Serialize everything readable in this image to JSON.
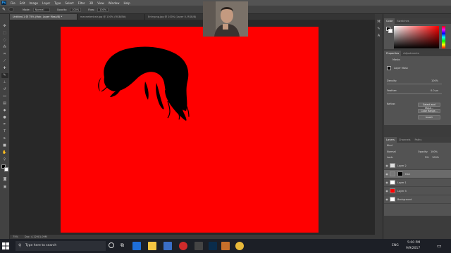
{
  "app": {
    "logo": "Ps"
  },
  "menu": [
    "File",
    "Edit",
    "Image",
    "Layer",
    "Type",
    "Select",
    "Filter",
    "3D",
    "View",
    "Window",
    "Help"
  ],
  "options": {
    "mode_label": "Mode:",
    "mode_value": "Normal",
    "opacity_label": "Opacity:",
    "opacity_value": "100%",
    "flow_label": "Flow:",
    "flow_value": "100%"
  },
  "tabs": [
    {
      "label": "Untitled-1 @ 75% (Hair, Layer Mask/8) *",
      "active": true
    },
    {
      "label": "mannekenhair.jpg @ 100% (RGB/8#)",
      "active": false
    },
    {
      "label": "Entrypng.jpg @ 100% (Layer 0, RGB/8)",
      "active": false
    }
  ],
  "statusbar": {
    "zoom": "75%",
    "doc": "Doc: 4.12M/1.09M"
  },
  "color_panel": {
    "tabs": [
      "Color",
      "Swatches"
    ]
  },
  "properties": {
    "tabs": [
      "Properties",
      "Adjustments"
    ],
    "section": "Masks",
    "mask_type": "Layer Mask",
    "density_label": "Density:",
    "density_value": "100%",
    "feather_label": "Feather:",
    "feather_value": "0.0 px",
    "refine_label": "Refine:",
    "buttons": [
      "Select and Mask...",
      "Color Range...",
      "Invert"
    ]
  },
  "layers": {
    "tabs": [
      "Layers",
      "Channels",
      "Paths"
    ],
    "filter_kind": "Kind",
    "blend_mode": "Normal",
    "opacity_label": "Opacity:",
    "opacity_value": "100%",
    "lock_label": "Lock:",
    "fill_label": "Fill:",
    "fill_value": "100%",
    "items": [
      {
        "name": "Layer 2",
        "thumb": "#dddddd",
        "selected": false,
        "mask": false
      },
      {
        "name": "Hair",
        "thumb": "#777777",
        "selected": true,
        "mask": true
      },
      {
        "name": "Layer 1",
        "thumb": "#ffffff",
        "selected": false,
        "mask": false
      },
      {
        "name": "Layer 3",
        "thumb": "#ff0000",
        "selected": false,
        "mask": false
      },
      {
        "name": "Background",
        "thumb": "#ffffff",
        "selected": false,
        "mask": false
      }
    ]
  },
  "taskbar": {
    "search_placeholder": "Type here to search",
    "lang": "ENG",
    "time": "5:00 PM",
    "date": "9/9/2017"
  },
  "colors": {
    "canvas": "#ff0000",
    "ps_blue": "#31a8ff",
    "panel": "#535353"
  }
}
